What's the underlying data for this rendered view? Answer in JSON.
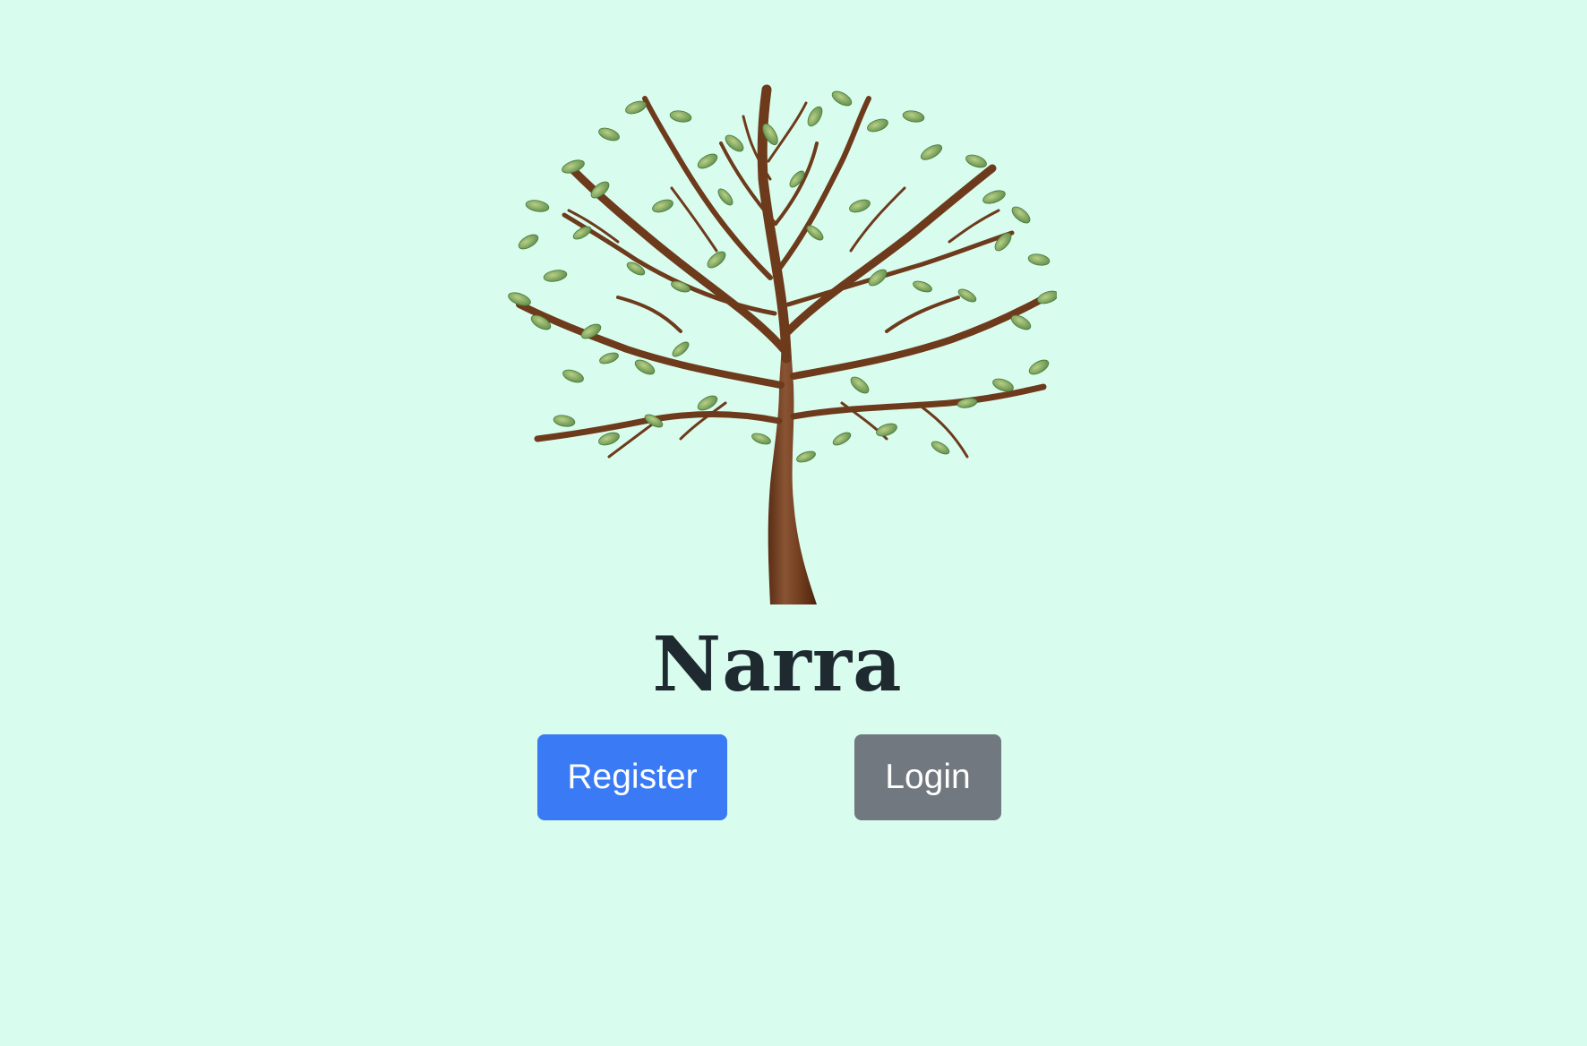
{
  "app": {
    "title": "Narra"
  },
  "logo": {
    "icon": "tree-icon"
  },
  "actions": {
    "register_label": "Register",
    "login_label": "Login"
  },
  "colors": {
    "background": "#d8fdee",
    "primary": "#3a7bf5",
    "secondary": "#71787f",
    "title": "#1f2a30",
    "trunk": "#6e3a1c",
    "leaf": "#6f9a55"
  }
}
